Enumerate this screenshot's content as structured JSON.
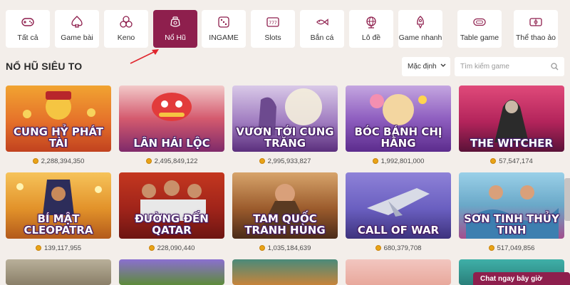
{
  "categories": [
    {
      "label": "Tất cả",
      "icon": "gamepad-icon"
    },
    {
      "label": "Game bài",
      "icon": "spade-icon"
    },
    {
      "label": "Keno",
      "icon": "keno-balls-icon"
    },
    {
      "label": "Nổ Hũ",
      "icon": "jackpot-pot-icon",
      "active": true
    },
    {
      "label": "INGAME",
      "icon": "dice-icon"
    },
    {
      "label": "Slots",
      "icon": "slot-777-icon"
    },
    {
      "label": "Bắn cá",
      "icon": "fish-icon"
    },
    {
      "label": "Lô đề",
      "icon": "lottery-globe-icon"
    },
    {
      "label": "Game nhanh",
      "icon": "rocket-icon"
    },
    {
      "label": "Table game",
      "icon": "table-game-icon"
    },
    {
      "label": "Thể thao ảo",
      "icon": "virtual-sports-icon"
    }
  ],
  "section": {
    "title": "NỔ HŨ SIÊU TO"
  },
  "sort": {
    "label": "Mặc định"
  },
  "search": {
    "placeholder": "Tìm kiếm game"
  },
  "games": [
    {
      "title": "CUNG HỶ PHÁT TÀI",
      "jackpot": "2,288,394,350"
    },
    {
      "title": "LÂN HÁI LỘC",
      "jackpot": "2,495,849,122"
    },
    {
      "title": "VƯƠN TỚI CUNG TRĂNG",
      "jackpot": "2,995,933,827"
    },
    {
      "title": "BÓC BÁNH CHỊ HẰNG",
      "jackpot": "1,992,801,000"
    },
    {
      "title": "THE WITCHER",
      "jackpot": "57,547,174"
    },
    {
      "title": "BÍ MẬT CLEOPATRA",
      "jackpot": "139,117,955"
    },
    {
      "title": "ĐƯỜNG ĐẾN QATAR",
      "jackpot": "228,090,440"
    },
    {
      "title": "TAM QUỐC TRANH HÙNG",
      "jackpot": "1,035,184,639"
    },
    {
      "title": "CALL OF WAR",
      "jackpot": "680,379,708"
    },
    {
      "title": "SƠN TINH THỦY TINH",
      "jackpot": "517,049,856"
    }
  ],
  "chat": {
    "label": "Chat ngay bây giờ"
  },
  "colors": {
    "accent": "#8e1f4d",
    "coin": "#e8a317",
    "background": "#f3eeea",
    "arrow": "#e0262e"
  }
}
